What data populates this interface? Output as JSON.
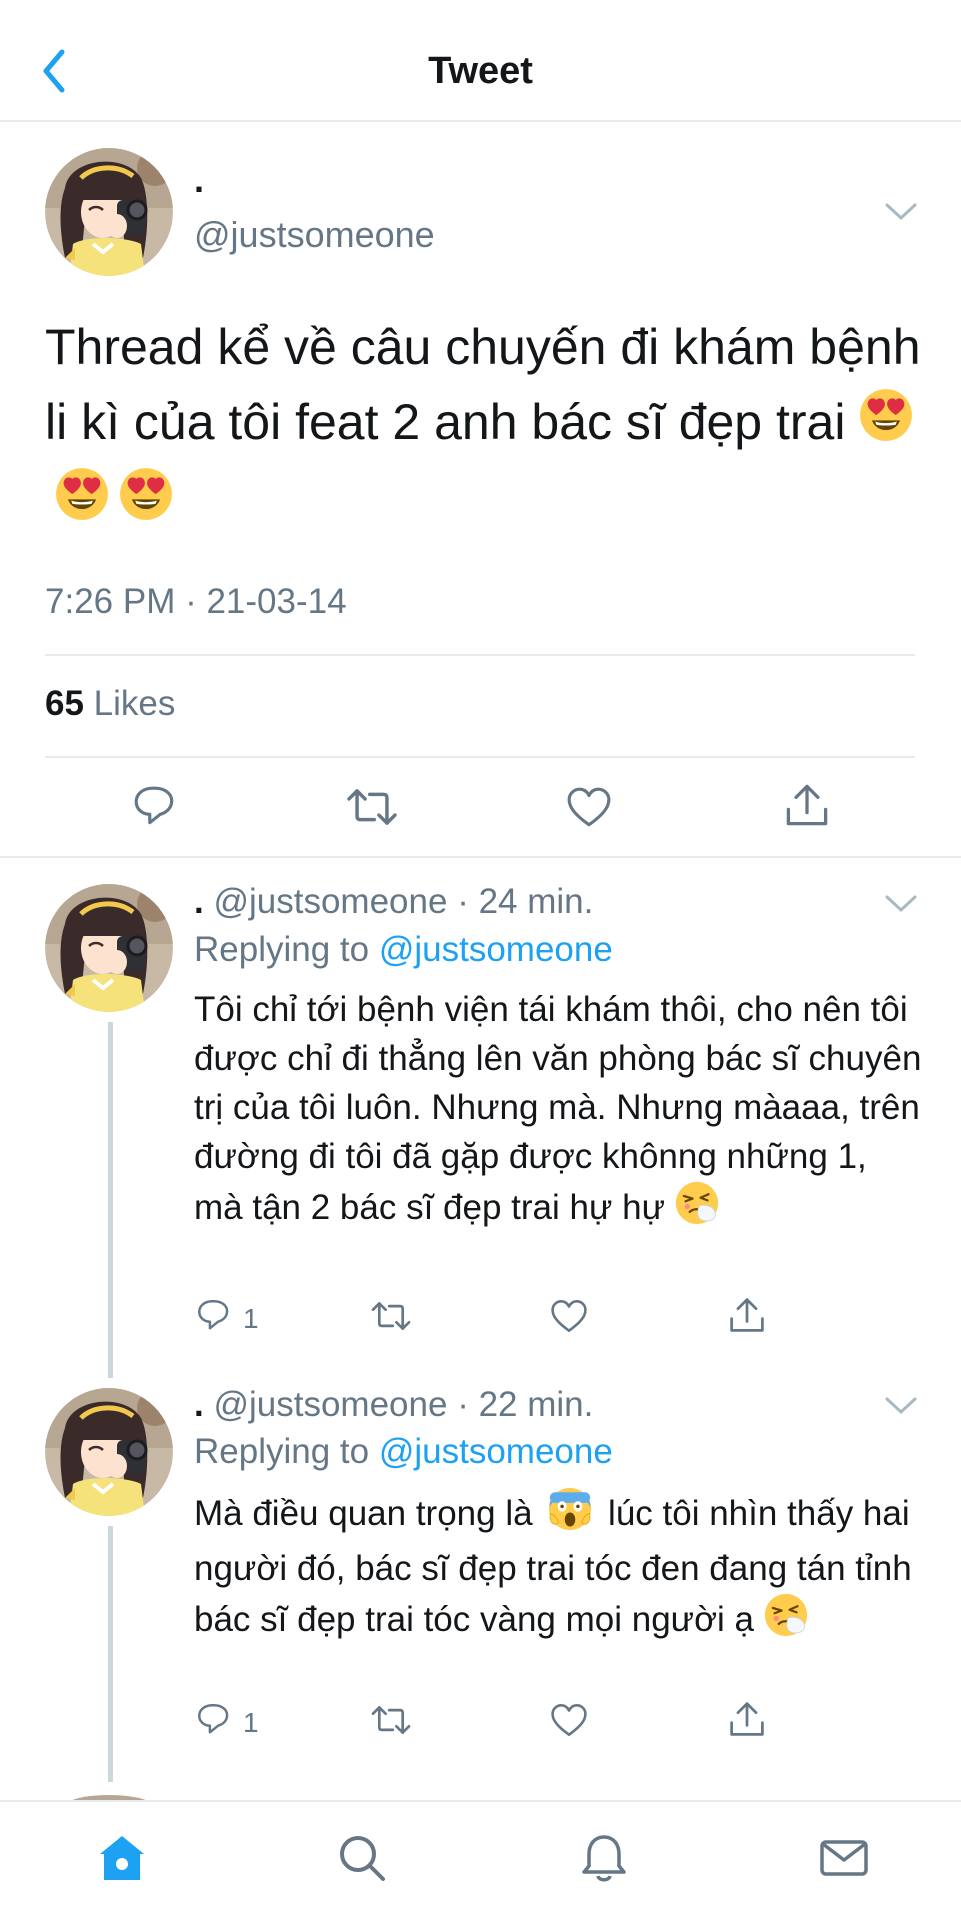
{
  "header": {
    "title": "Tweet"
  },
  "main_tweet": {
    "name": ".",
    "handle": "@justsomeone",
    "text": "Thread kể về câu chuyến đi khám bệnh li kì của tôi feat 2 anh bác sĩ đẹp trai",
    "emojis": [
      "heart-eyes-emoji",
      "heart-eyes-emoji",
      "heart-eyes-emoji"
    ],
    "timestamp": "7:26 PM · 21-03-14",
    "likes_count": "65",
    "likes_label": "Likes"
  },
  "replies": [
    {
      "name": ".",
      "handle": "@justsomeone",
      "sep": "·",
      "time": "24 min.",
      "replying_label": "Replying to",
      "replying_to": "@justsomeone",
      "text": "Tôi chỉ tới bệnh viện tái khám thôi, cho nên tôi được chỉ đi thẳng lên văn phòng bác sĩ chuyên trị của tôi luôn. Nhưng mà. Nhưng màaaa, trên đường đi tôi đã gặp được khônng những 1, mà tận 2 bác sĩ đẹp trai hự hự",
      "reply_count": "1"
    },
    {
      "name": ".",
      "handle": "@justsomeone",
      "sep": "·",
      "time": "22 min.",
      "replying_label": "Replying to",
      "replying_to": "@justsomeone",
      "text_before": "Mà điều quan trọng là",
      "text_after": "lúc tôi nhìn thấy hai người đó, bác sĩ đẹp trai tóc đen đang tán tỉnh bác sĩ đẹp trai tóc vàng mọi người ạ",
      "reply_count": "1"
    }
  ],
  "colors": {
    "accent": "#1da1f2",
    "secondary_text": "#657786",
    "divider": "#e6ecf0"
  },
  "icons": [
    "back-chevron-icon",
    "caret-down-icon",
    "reply-icon",
    "retweet-icon",
    "like-icon",
    "share-icon",
    "home-icon",
    "search-icon",
    "notifications-icon",
    "messages-icon"
  ]
}
